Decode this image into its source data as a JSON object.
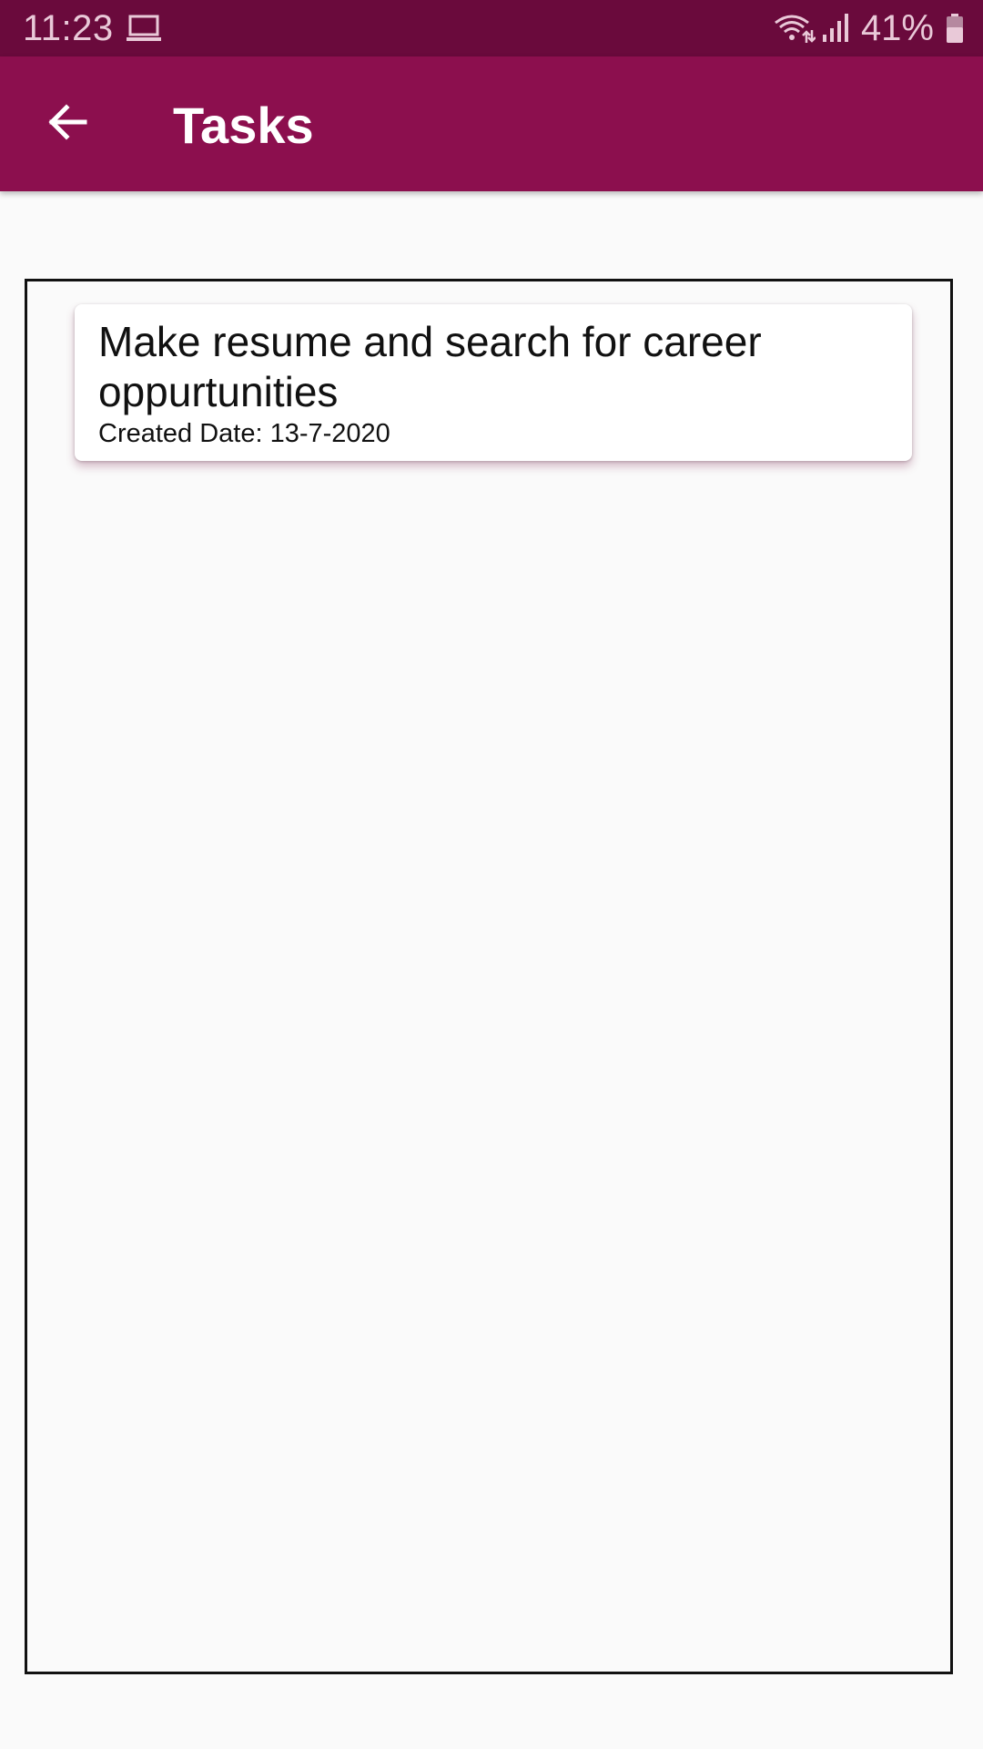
{
  "status_bar": {
    "time": "11:23",
    "battery": "41%",
    "icons": [
      "laptop-icon",
      "wifi-icon",
      "signal-icon",
      "battery-icon"
    ]
  },
  "app_bar": {
    "title": "Tasks",
    "back_icon": "arrow-back-icon"
  },
  "tasks": [
    {
      "title": "Make resume and search for career oppurtunities",
      "created": "Created Date: 13-7-2020"
    }
  ],
  "colors": {
    "status_bar": "#6a0a3c",
    "app_bar": "#8c0f4e",
    "background": "#fafafa",
    "card": "#ffffff"
  }
}
